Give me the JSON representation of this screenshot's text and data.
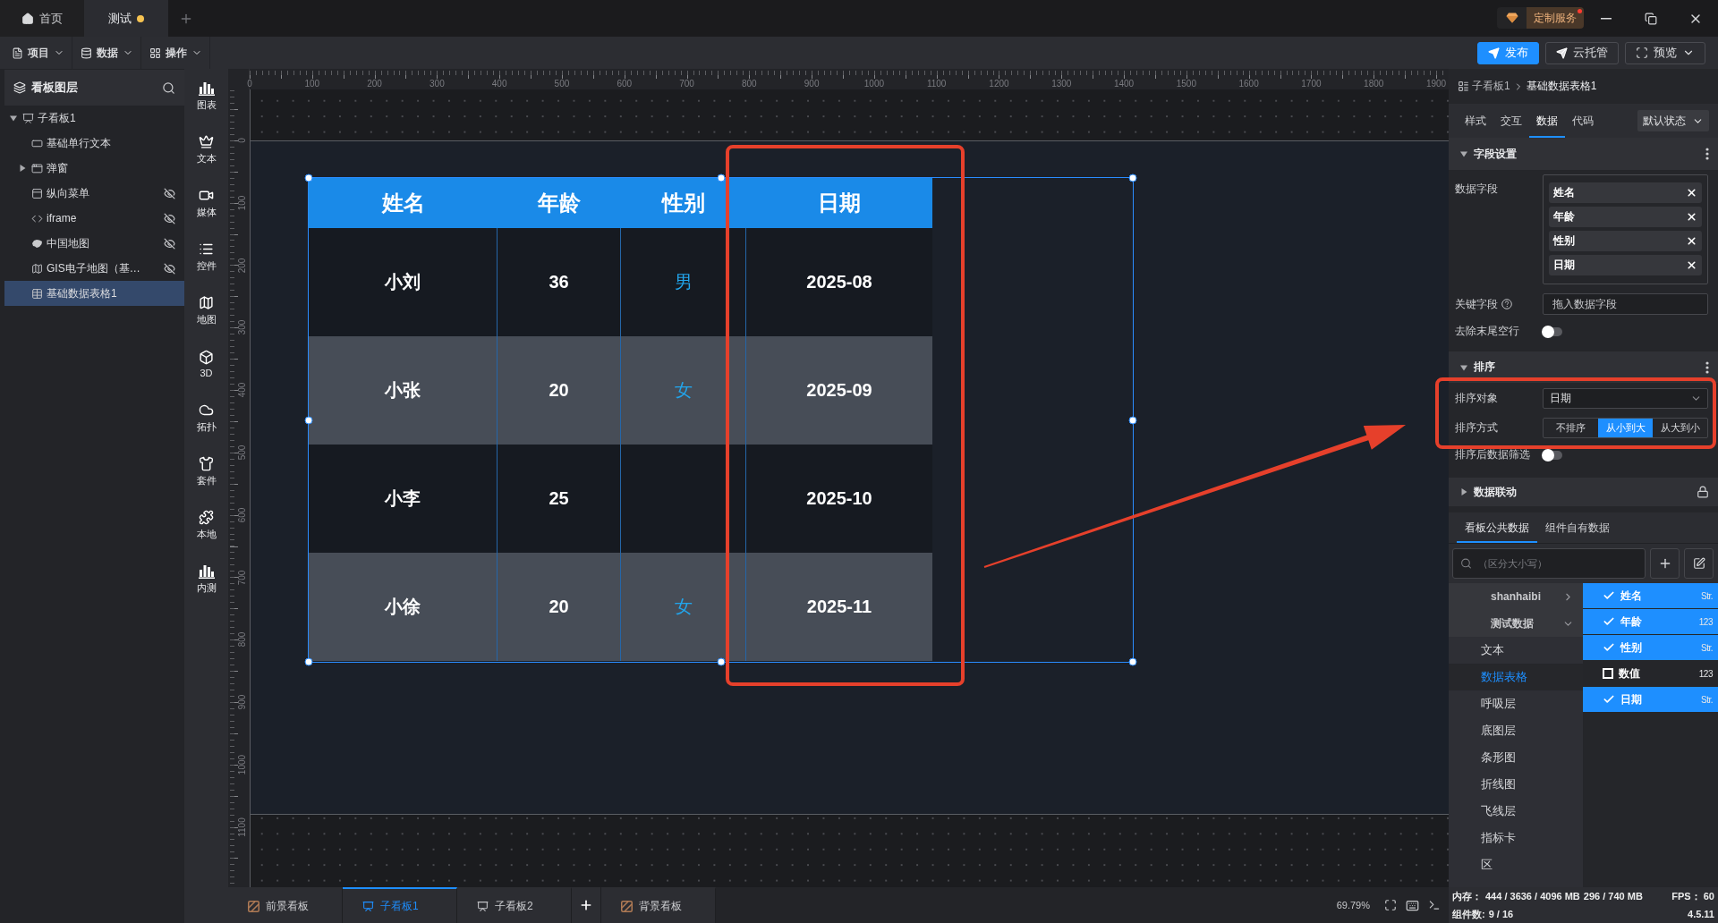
{
  "title_bar": {
    "tabs": [
      {
        "label": "首页",
        "kind": "home",
        "selected": false
      },
      {
        "label": "测试",
        "kind": "document",
        "selected": true,
        "unsaved": true
      }
    ],
    "service_badge": "定制服务",
    "service_notification": true
  },
  "toolbar": {
    "menus": [
      {
        "label": "项目",
        "kind": "project"
      },
      {
        "label": "数据",
        "kind": "data"
      },
      {
        "label": "操作",
        "kind": "operation"
      }
    ],
    "actions": [
      {
        "label": "发布",
        "kind": "primary"
      },
      {
        "label": "云托管",
        "kind": "secondary"
      },
      {
        "label": "预览",
        "kind": "dropdown"
      }
    ]
  },
  "layers_panel": {
    "title": "看板图层",
    "tree": [
      {
        "label": "子看板1",
        "kind": "board",
        "expanded": true,
        "selected": false,
        "children": [
          {
            "label": "基础单行文本",
            "kind": "text",
            "selected": false,
            "hidden": false
          },
          {
            "label": "弹窗",
            "kind": "popup",
            "expanded": false,
            "selected": false,
            "hidden": false
          },
          {
            "label": "纵向菜单",
            "kind": "menu",
            "selected": false,
            "hidden": true
          },
          {
            "label": "iframe",
            "kind": "iframe",
            "selected": false,
            "hidden": true
          },
          {
            "label": "中国地图",
            "kind": "country",
            "selected": false,
            "hidden": true
          },
          {
            "label": "GIS电子地图（基…",
            "kind": "gis",
            "selected": false,
            "hidden": true
          },
          {
            "label": "基础数据表格1",
            "kind": "table",
            "selected": true,
            "hidden": false
          }
        ]
      }
    ]
  },
  "component_bar": [
    {
      "label": "图表",
      "kind": "chart"
    },
    {
      "label": "文本",
      "kind": "text"
    },
    {
      "label": "媒体",
      "kind": "media"
    },
    {
      "label": "控件",
      "kind": "control"
    },
    {
      "label": "地图",
      "kind": "map"
    },
    {
      "label": "3D",
      "kind": "solid"
    },
    {
      "label": "拓扑",
      "kind": "topology"
    },
    {
      "label": "套件",
      "kind": "kit"
    },
    {
      "label": "本地",
      "kind": "local"
    },
    {
      "label": "内测",
      "kind": "beta"
    }
  ],
  "rulers": {
    "horizontal": [
      "0",
      "100",
      "200",
      "300",
      "400",
      "500",
      "600",
      "700",
      "800",
      "900",
      "1000",
      "1100",
      "1200",
      "1300",
      "1400",
      "1500",
      "1600",
      "1700",
      "1800",
      "1900"
    ],
    "vertical": [
      "0",
      "100",
      "200",
      "300",
      "400",
      "500",
      "600",
      "700",
      "800",
      "900",
      "1000",
      "1100"
    ]
  },
  "canvas": {
    "table": {
      "columns": [
        "姓名",
        "年龄",
        "性别",
        "日期"
      ],
      "rows": [
        {
          "name": "小刘",
          "age": "36",
          "gender": "男",
          "date": "2025-08"
        },
        {
          "name": "小张",
          "age": "20",
          "gender": "女",
          "date": "2025-09"
        },
        {
          "name": "小李",
          "age": "25",
          "date": "2025-10"
        },
        {
          "name": "小徐",
          "age": "20",
          "gender": "女",
          "date": "2025-11"
        }
      ]
    }
  },
  "board_tabs": [
    {
      "label": "前景看板",
      "kind": "foreground",
      "selected": false
    },
    {
      "label": "子看板1",
      "kind": "board",
      "selected": true
    },
    {
      "label": "子看板2",
      "kind": "board",
      "selected": false
    },
    {
      "label": "背景看板",
      "kind": "background",
      "selected": false
    }
  ],
  "zoom_level": "69.79%",
  "inspector": {
    "breadcrumb": [
      "子看板1",
      "基础数据表格1"
    ],
    "tabs": [
      {
        "label": "样式",
        "selected": false
      },
      {
        "label": "交互",
        "selected": false
      },
      {
        "label": "数据",
        "selected": true
      },
      {
        "label": "代码",
        "selected": false
      }
    ],
    "state_select": "默认状态",
    "field_section": {
      "title": "字段设置",
      "expanded": true,
      "data_fields_label": "数据字段",
      "data_fields": [
        "姓名",
        "年龄",
        "性别",
        "日期"
      ],
      "key_field": {
        "label": "关键字段",
        "placeholder": "拖入数据字段"
      },
      "trim_rows": {
        "label": "去除末尾空行",
        "on": false
      }
    },
    "sort_section": {
      "title": "排序",
      "expanded": true,
      "target": {
        "label": "排序对象",
        "value": "日期"
      },
      "mode": {
        "label": "排序方式",
        "options": [
          {
            "label": "不排序",
            "selected": false
          },
          {
            "label": "从小到大",
            "selected": true
          },
          {
            "label": "从大到小",
            "selected": false
          }
        ]
      },
      "filter_after_sort": {
        "label": "排序后数据筛选",
        "on": false
      }
    },
    "linkage_section": {
      "title": "数据联动",
      "expanded": false,
      "locked": true
    },
    "data_source": {
      "tabs": [
        {
          "label": "看板公共数据",
          "selected": true
        },
        {
          "label": "组件自有数据",
          "selected": false
        }
      ],
      "search_placeholder": "（区分大小写）",
      "groups": [
        {
          "label": "shanhaibi",
          "expanded": false
        },
        {
          "label": "测试数据",
          "expanded": true,
          "datasets": [
            {
              "label": "文本",
              "selected": false
            },
            {
              "label": "数据表格",
              "selected": true
            },
            {
              "label": "呼吸层",
              "selected": false
            },
            {
              "label": "底图层",
              "selected": false
            },
            {
              "label": "条形图",
              "selected": false
            },
            {
              "label": "折线图",
              "selected": false
            },
            {
              "label": "飞线层",
              "selected": false
            },
            {
              "label": "指标卡",
              "selected": false
            },
            {
              "label": "区",
              "selected": false
            }
          ]
        }
      ],
      "fields": [
        {
          "label": "姓名",
          "type": "Str.",
          "checked": true
        },
        {
          "label": "年龄",
          "type": "123",
          "checked": true
        },
        {
          "label": "性别",
          "type": "Str.",
          "checked": true
        },
        {
          "label": "数值",
          "type": "123",
          "checked": false
        },
        {
          "label": "日期",
          "type": "Str.",
          "checked": true
        }
      ]
    }
  },
  "status": {
    "memory_label": "内存：",
    "memory_values": [
      "444 / 3636 / 4096 MB",
      "296 / 740 MB"
    ],
    "fps_label": "FPS：",
    "fps": "60",
    "components_label": "组件数:",
    "components": "9 / 16",
    "version": "4.5.11"
  }
}
